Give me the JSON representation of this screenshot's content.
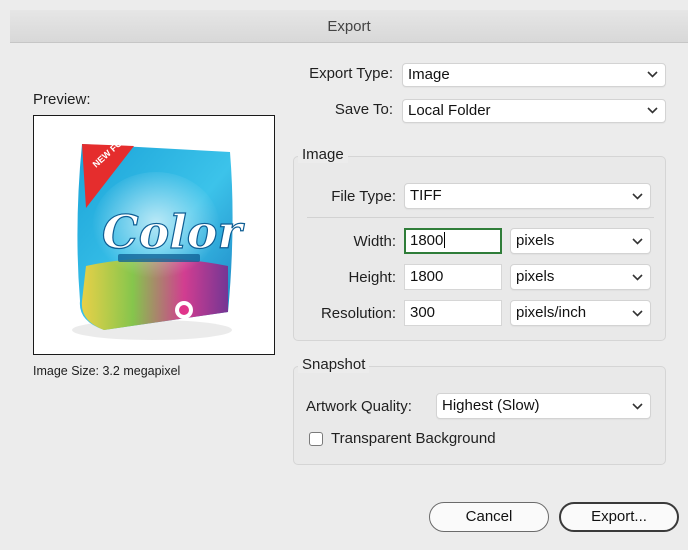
{
  "window": {
    "title": "Export"
  },
  "preview": {
    "label": "Preview:",
    "image_size": "Image Size: 3.2 megapixel",
    "product_brand": "Color",
    "product_badge": "NEW FORMULA+"
  },
  "export_type": {
    "label": "Export Type:",
    "value": "Image"
  },
  "save_to": {
    "label": "Save To:",
    "value": "Local Folder"
  },
  "image_group": {
    "title": "Image",
    "file_type": {
      "label": "File Type:",
      "value": "TIFF"
    },
    "width": {
      "label": "Width:",
      "value": "1800",
      "unit": "pixels"
    },
    "height": {
      "label": "Height:",
      "value": "1800",
      "unit": "pixels"
    },
    "resolution": {
      "label": "Resolution:",
      "value": "300",
      "unit": "pixels/inch"
    }
  },
  "snapshot_group": {
    "title": "Snapshot",
    "artwork_quality": {
      "label": "Artwork Quality:",
      "value": "Highest (Slow)"
    },
    "transparent_background": {
      "label": "Transparent Background",
      "checked": false
    }
  },
  "buttons": {
    "cancel": "Cancel",
    "export": "Export..."
  },
  "icons": {
    "dropdown": "chevron-down-icon",
    "checkbox": "checkbox-icon"
  }
}
